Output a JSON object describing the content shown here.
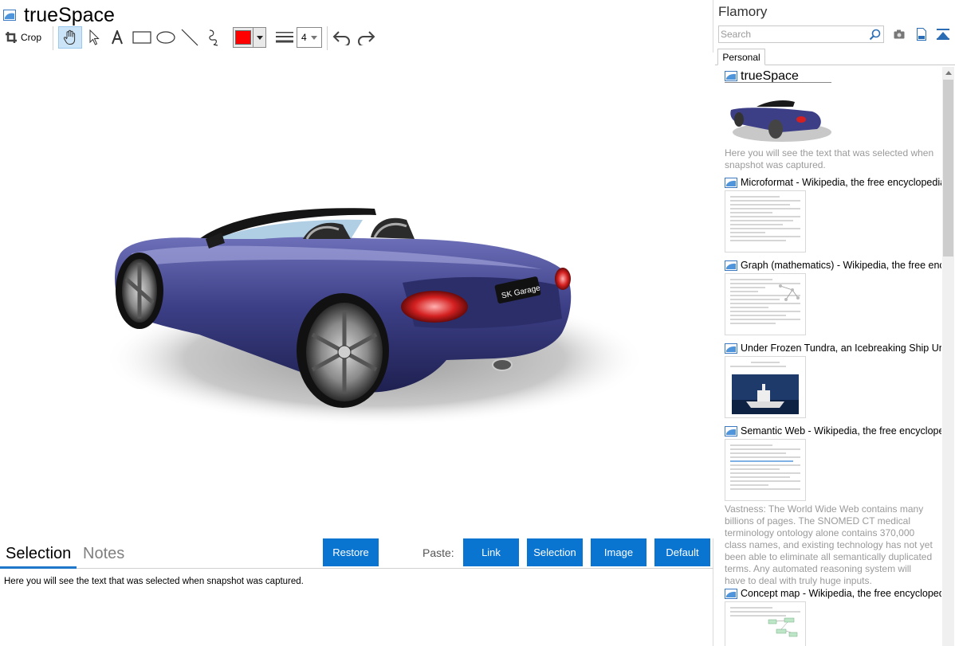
{
  "window": {
    "title": "trueSpace"
  },
  "toolbar": {
    "crop_label": "Crop",
    "line_width_value": "4",
    "stroke_color": "#ff0000"
  },
  "canvas": {
    "plate_text": "SK Garage",
    "car_color": "#3b3d7c"
  },
  "bottom": {
    "tabs": [
      {
        "label": "Selection"
      },
      {
        "label": "Notes"
      }
    ],
    "restore_label": "Restore",
    "paste_label": "Paste:",
    "paste_buttons": [
      "Link",
      "Selection",
      "Image",
      "Default"
    ],
    "selection_text": "Here you will see the text that was selected when snapshot was captured."
  },
  "flamory": {
    "title": "Flamory",
    "search_placeholder": "Search",
    "tab": "Personal",
    "items": [
      {
        "title": "trueSpace",
        "desc": "Here you will see the text that was selected when snapshot was captured."
      },
      {
        "title": "Microformat - Wikipedia, the free encyclopedia"
      },
      {
        "title": "Graph (mathematics) - Wikipedia, the free ency"
      },
      {
        "title": "Under Frozen Tundra, an Icebreaking Ship Unco"
      },
      {
        "title": "Semantic Web - Wikipedia, the free encycloped",
        "desc": "Vastness: The World Wide Web contains many billions of pages. The SNOMED CT medical terminology ontology alone contains 370,000 class names, and existing technology has not yet been able to eliminate all semantically duplicated terms. Any automated reasoning system will have to deal with truly huge inputs."
      },
      {
        "title": "Concept map - Wikipedia, the free encyclopedia"
      }
    ]
  },
  "colors": {
    "accent": "#0a74d1",
    "selected_tool": "#cce4f7"
  }
}
